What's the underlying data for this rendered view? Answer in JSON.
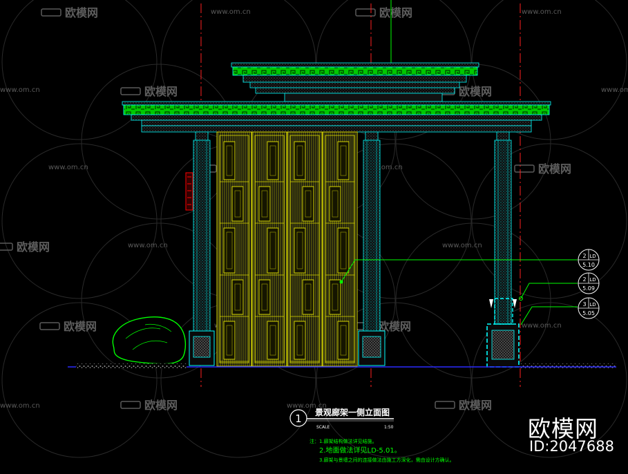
{
  "watermark": {
    "url_text": "www.om.cn",
    "logo_text": "欧模网"
  },
  "drawing": {
    "title": "景观廊架一侧立面图",
    "number": "1",
    "scale_label": "SCALE",
    "scale_value": "1:50",
    "notes": [
      "注：1.廊架结构做法详见结施。",
      "2.地面做法详见LD-5.01。",
      "3.廊架与景墙之间的连接做法由施工方深化，需由设计方确认。"
    ],
    "callouts": [
      {
        "top": "2",
        "mid": "LD",
        "bottom": "5.10"
      },
      {
        "top": "2",
        "mid": "LD",
        "bottom": "5.09"
      },
      {
        "top": "3",
        "mid": "LD",
        "bottom": "5.05"
      }
    ]
  },
  "brand": {
    "name": "欧模网",
    "id": "ID:2047688"
  },
  "colors": {
    "background": "#000000",
    "green": "#00ff00",
    "cyan": "#00ffff",
    "yellow": "#d8d800",
    "red": "#ff0000",
    "blue": "#2a2aff"
  }
}
